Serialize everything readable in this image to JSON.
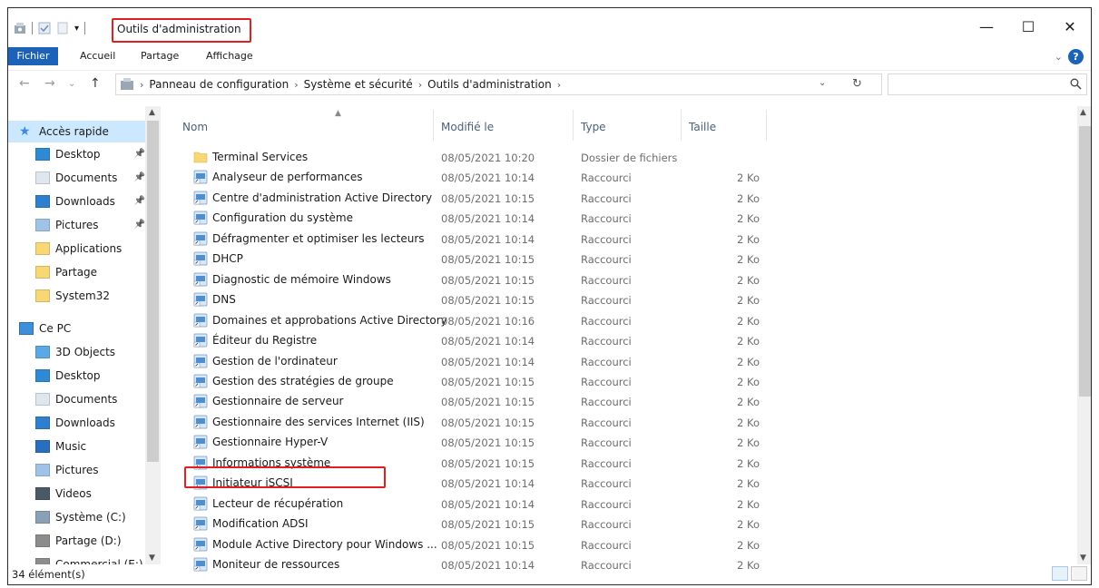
{
  "window": {
    "title": "Outils d'administration",
    "controls": {
      "minimize": "—",
      "maximize": "☐",
      "close": "✕"
    }
  },
  "ribbon": {
    "tabs": [
      "Fichier",
      "Accueil",
      "Partage",
      "Affichage"
    ],
    "help": "?"
  },
  "address": {
    "crumbs": [
      "Panneau de configuration",
      "Système et sécurité",
      "Outils d'administration"
    ],
    "search_placeholder": ""
  },
  "nav": {
    "quick_access": "Accès rapide",
    "quick_items": [
      "Desktop",
      "Documents",
      "Downloads",
      "Pictures",
      "Applications",
      "Partage",
      "System32"
    ],
    "this_pc": "Ce PC",
    "pc_items": [
      "3D Objects",
      "Desktop",
      "Documents",
      "Downloads",
      "Music",
      "Pictures",
      "Videos",
      "Système (C:)",
      "Partage (D:)",
      "Commercial (E:)"
    ]
  },
  "columns": {
    "name": "Nom",
    "modified": "Modifié le",
    "type": "Type",
    "size": "Taille"
  },
  "files": [
    {
      "name": "Terminal Services",
      "date": "08/05/2021 10:20",
      "type": "Dossier de fichiers",
      "size": "",
      "icon": "folder-icon"
    },
    {
      "name": "Analyseur de performances",
      "date": "08/05/2021 10:14",
      "type": "Raccourci",
      "size": "2 Ko",
      "icon": "performance-icon"
    },
    {
      "name": "Centre d'administration Active Directory",
      "date": "08/05/2021 10:15",
      "type": "Raccourci",
      "size": "2 Ko",
      "icon": "ad-admin-icon"
    },
    {
      "name": "Configuration du système",
      "date": "08/05/2021 10:14",
      "type": "Raccourci",
      "size": "2 Ko",
      "icon": "sysconfig-icon"
    },
    {
      "name": "Défragmenter et optimiser les lecteurs",
      "date": "08/05/2021 10:14",
      "type": "Raccourci",
      "size": "2 Ko",
      "icon": "defrag-icon"
    },
    {
      "name": "DHCP",
      "date": "08/05/2021 10:15",
      "type": "Raccourci",
      "size": "2 Ko",
      "icon": "dhcp-icon"
    },
    {
      "name": "Diagnostic de mémoire Windows",
      "date": "08/05/2021 10:15",
      "type": "Raccourci",
      "size": "2 Ko",
      "icon": "memory-icon"
    },
    {
      "name": "DNS",
      "date": "08/05/2021 10:15",
      "type": "Raccourci",
      "size": "2 Ko",
      "icon": "dns-icon"
    },
    {
      "name": "Domaines et approbations Active Directory",
      "date": "08/05/2021 10:16",
      "type": "Raccourci",
      "size": "2 Ko",
      "icon": "ad-domains-icon"
    },
    {
      "name": "Éditeur du Registre",
      "date": "08/05/2021 10:14",
      "type": "Raccourci",
      "size": "2 Ko",
      "icon": "registry-icon"
    },
    {
      "name": "Gestion de l'ordinateur",
      "date": "08/05/2021 10:14",
      "type": "Raccourci",
      "size": "2 Ko",
      "icon": "computer-mgmt-icon"
    },
    {
      "name": "Gestion des stratégies de groupe",
      "date": "08/05/2021 10:15",
      "type": "Raccourci",
      "size": "2 Ko",
      "icon": "gpo-icon"
    },
    {
      "name": "Gestionnaire de serveur",
      "date": "08/05/2021 10:15",
      "type": "Raccourci",
      "size": "2 Ko",
      "icon": "server-manager-icon"
    },
    {
      "name": "Gestionnaire des services Internet (IIS)",
      "date": "08/05/2021 10:15",
      "type": "Raccourci",
      "size": "2 Ko",
      "icon": "iis-icon"
    },
    {
      "name": "Gestionnaire Hyper-V",
      "date": "08/05/2021 10:15",
      "type": "Raccourci",
      "size": "2 Ko",
      "icon": "hyperv-icon"
    },
    {
      "name": "Informations système",
      "date": "08/05/2021 10:15",
      "type": "Raccourci",
      "size": "2 Ko",
      "icon": "sysinfo-icon"
    },
    {
      "name": "Initiateur iSCSI",
      "date": "08/05/2021 10:14",
      "type": "Raccourci",
      "size": "2 Ko",
      "icon": "iscsi-icon"
    },
    {
      "name": "Lecteur de récupération",
      "date": "08/05/2021 10:14",
      "type": "Raccourci",
      "size": "2 Ko",
      "icon": "recovery-drive-icon"
    },
    {
      "name": "Modification ADSI",
      "date": "08/05/2021 10:15",
      "type": "Raccourci",
      "size": "2 Ko",
      "icon": "adsi-icon"
    },
    {
      "name": "Module Active Directory pour Windows ...",
      "date": "08/05/2021 10:15",
      "type": "Raccourci",
      "size": "2 Ko",
      "icon": "ad-module-icon"
    },
    {
      "name": "Moniteur de ressources",
      "date": "08/05/2021 10:14",
      "type": "Raccourci",
      "size": "2 Ko",
      "icon": "resource-monitor-icon"
    }
  ],
  "status": {
    "count": "34 élément(s)"
  },
  "colors": {
    "accent": "#1c62b9",
    "annotation": "#e02020",
    "folder": "#f8d775"
  }
}
